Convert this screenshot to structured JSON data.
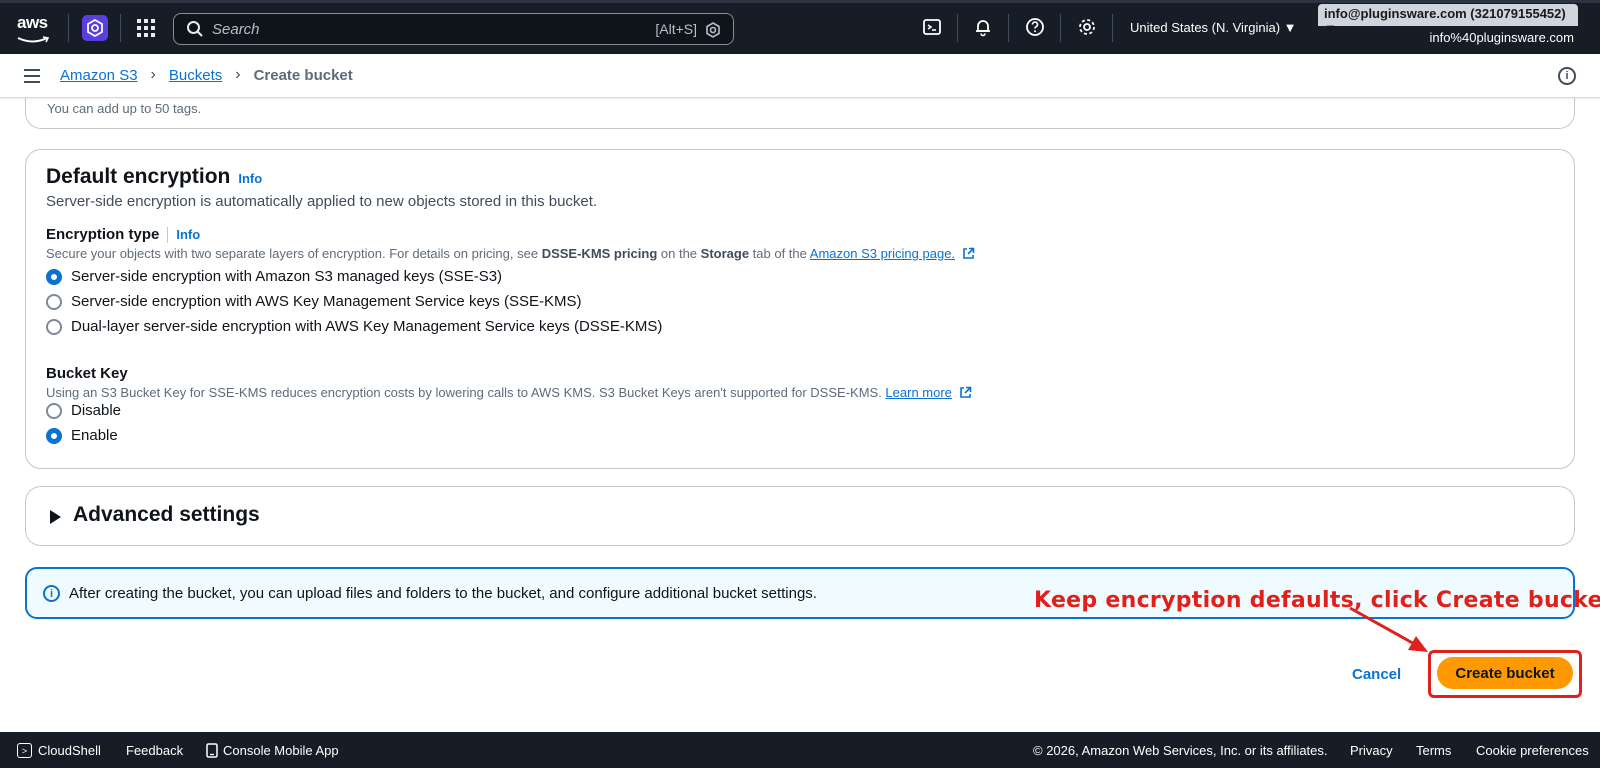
{
  "topnav": {
    "logo_text": "aws",
    "search_placeholder": "Search",
    "search_shortcut": "[Alt+S]",
    "region": "United States (N. Virginia) ▼",
    "account": "info@pluginsware.com (321079155452) ▼",
    "account_sub": "info%40pluginsware.com"
  },
  "breadcrumb": {
    "items": [
      "Amazon S3",
      "Buckets"
    ],
    "current": "Create bucket"
  },
  "tags_card": {
    "hint": "You can add up to 50 tags."
  },
  "encryption": {
    "title": "Default encryption",
    "info": "Info",
    "description": "Server-side encryption is automatically applied to new objects stored in this bucket.",
    "type_label": "Encryption type",
    "type_info": "Info",
    "type_desc_1": "Secure your objects with two separate layers of encryption. For details on pricing, see ",
    "type_desc_bold_1": "DSSE-KMS pricing",
    "type_desc_2": " on the ",
    "type_desc_bold_2": "Storage",
    "type_desc_3": " tab of the ",
    "type_desc_link": "Amazon S3 pricing page.",
    "options": [
      "Server-side encryption with Amazon S3 managed keys (SSE-S3)",
      "Server-side encryption with AWS Key Management Service keys (SSE-KMS)",
      "Dual-layer server-side encryption with AWS Key Management Service keys (DSSE-KMS)"
    ],
    "selected_option": 0,
    "bucket_key_label": "Bucket Key",
    "bucket_key_desc": "Using an S3 Bucket Key for SSE-KMS reduces encryption costs by lowering calls to AWS KMS. S3 Bucket Keys aren't supported for DSSE-KMS. ",
    "bucket_key_link": "Learn more",
    "bucket_key_options": [
      "Disable",
      "Enable"
    ],
    "bucket_key_selected": 1
  },
  "advanced": {
    "title": "Advanced settings"
  },
  "alert": {
    "text": "After creating the bucket, you can upload files and folders to the bucket, and configure additional bucket settings."
  },
  "annotation": "Keep encryption defaults, click Create bucket",
  "actions": {
    "cancel": "Cancel",
    "create": "Create bucket"
  },
  "footer": {
    "cloudshell": "CloudShell",
    "feedback": "Feedback",
    "mobile": "Console Mobile App",
    "copyright": "© 2026, Amazon Web Services, Inc. or its affiliates.",
    "privacy": "Privacy",
    "terms": "Terms",
    "cookies": "Cookie preferences"
  },
  "colors": {
    "nav_bg": "#161d26",
    "link": "#0972d3",
    "primary_button": "#ff9900",
    "annotation_red": "#e0201b",
    "alert_bg": "#f0fbff"
  }
}
